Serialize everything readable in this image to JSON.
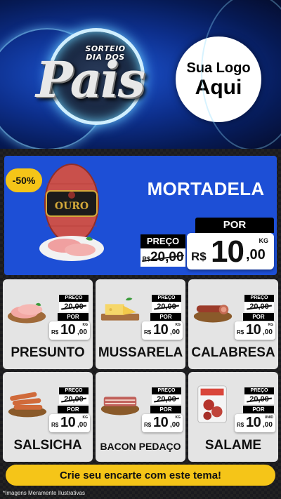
{
  "header": {
    "sorteio_line1": "SORTEIO",
    "sorteio_line2": "DIA DOS",
    "title": "Pais",
    "logo_line1": "Sua Logo",
    "logo_line2": "Aqui"
  },
  "hero": {
    "discount": "-50%",
    "name": "MORTADELA",
    "preco_label": "PREÇO",
    "por_label": "POR",
    "old_price": "20,00",
    "old_prefix": "R$",
    "currency": "R$",
    "new_int": "10",
    "new_cents": ",00",
    "unit": "KG",
    "brand_label": "OURO",
    "colors": {
      "background": "#1d4fd6",
      "badge": "#f5c518"
    }
  },
  "products": [
    {
      "name": "PRESUNTO",
      "preco_label": "PREÇO",
      "old_price": "20,00",
      "por_label": "POR",
      "currency": "R$",
      "new_int": "10",
      "new_cents": ",00",
      "unit": "KG",
      "icon": "ham-slices-icon"
    },
    {
      "name": "MUSSARELA",
      "preco_label": "PREÇO",
      "old_price": "20,00",
      "por_label": "POR",
      "currency": "R$",
      "new_int": "10",
      "new_cents": ",00",
      "unit": "KG",
      "icon": "cheese-icon"
    },
    {
      "name": "CALABRESA",
      "preco_label": "PREÇO",
      "old_price": "20,00",
      "por_label": "POR",
      "currency": "R$",
      "new_int": "10",
      "new_cents": ",00",
      "unit": "KG",
      "icon": "sausage-icon"
    },
    {
      "name": "SALSICHA",
      "preco_label": "PREÇO",
      "old_price": "20,00",
      "por_label": "POR",
      "currency": "R$",
      "new_int": "10",
      "new_cents": ",00",
      "unit": "KG",
      "icon": "hot-dog-sausage-icon"
    },
    {
      "name": "BACON PEDAÇO",
      "preco_label": "PREÇO",
      "old_price": "20,00",
      "por_label": "POR",
      "currency": "R$",
      "new_int": "10",
      "new_cents": ",00",
      "unit": "KG",
      "icon": "bacon-icon"
    },
    {
      "name": "SALAME",
      "preco_label": "PREÇO",
      "old_price": "20,00",
      "por_label": "POR",
      "currency": "R$",
      "new_int": "10",
      "new_cents": ",00",
      "unit": "UNID",
      "icon": "salami-pack-icon"
    }
  ],
  "cta": {
    "label": "Crie seu encarte com este tema!"
  },
  "disclaimer": "*Imagens Meramente Ilustrativas"
}
